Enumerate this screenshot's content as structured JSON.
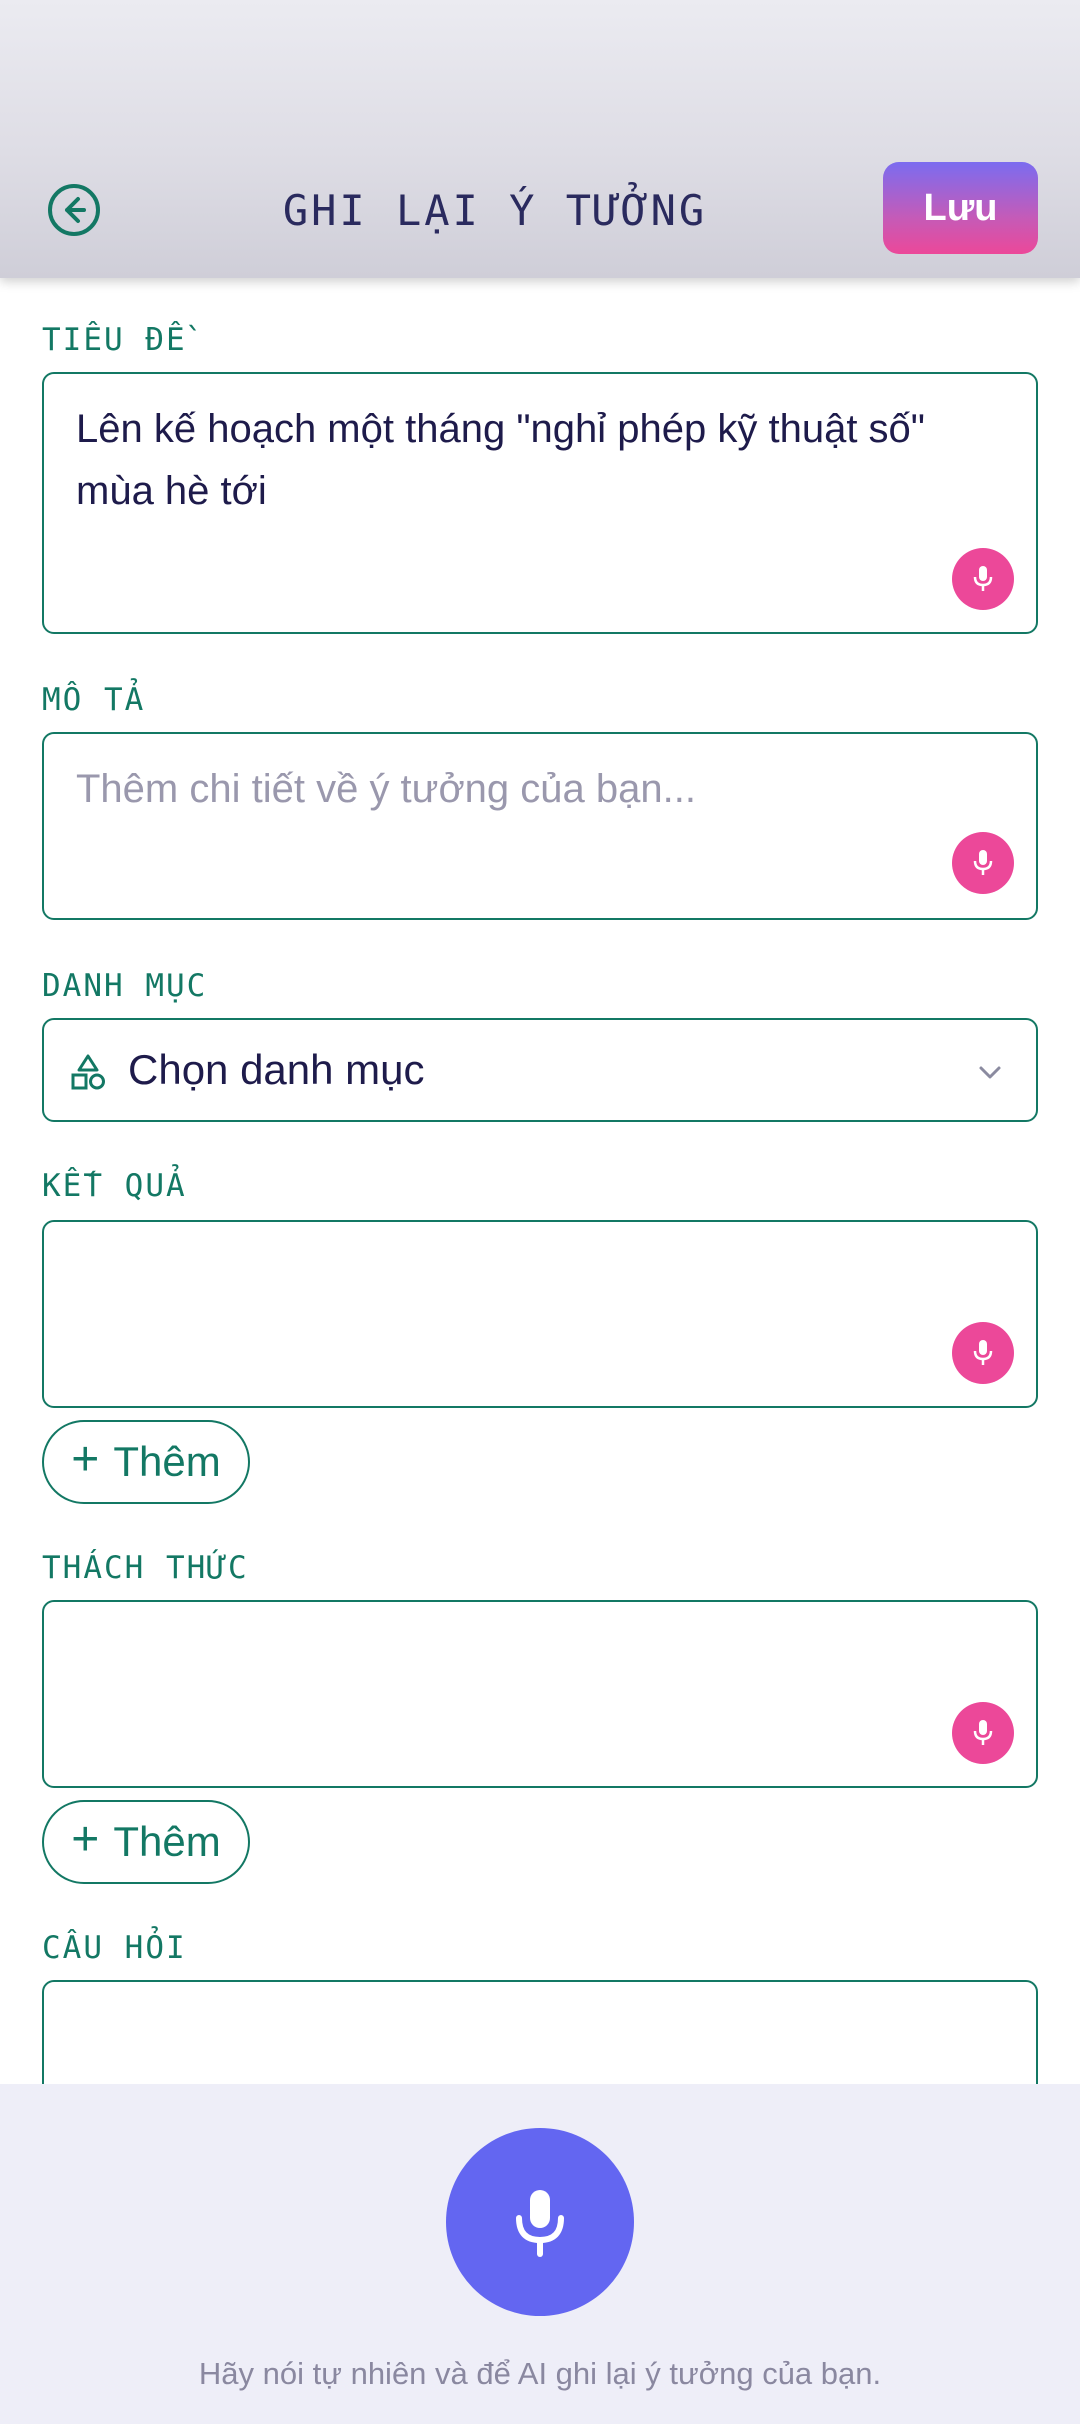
{
  "header": {
    "title": "GHI LẠI Ý TƯỞNG",
    "save_label": "Lưu",
    "back_icon": "arrow-left-circle-icon"
  },
  "form": {
    "title": {
      "label": "TIÊU ĐỀ",
      "value": "Lên kế hoạch một tháng \"nghỉ phép kỹ thuật số\" mùa hè tới"
    },
    "description": {
      "label": "MÔ TẢ",
      "placeholder": "Thêm chi tiết về ý tưởng của bạn..."
    },
    "category": {
      "label": "DANH MỤC",
      "value": "Chọn danh mục"
    },
    "results": {
      "label": "KẾT QUẢ",
      "add_label": "Thêm"
    },
    "challenges": {
      "label": "THÁCH THỨC",
      "add_label": "Thêm"
    },
    "questions": {
      "label": "CÂU HỎI"
    }
  },
  "dock": {
    "hint": "Hãy nói tự nhiên và để AI ghi lại ý tưởng của bạn."
  },
  "colors": {
    "accent_teal": "#137864",
    "mic_pink": "#ec4899",
    "mic_primary": "#6366f1"
  }
}
